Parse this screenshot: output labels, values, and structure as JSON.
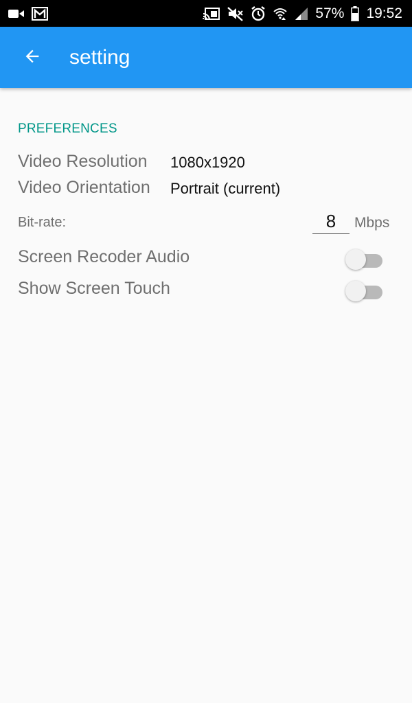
{
  "status_bar": {
    "battery": "57%",
    "time": "19:52",
    "left_icons": [
      "video-camera-icon",
      "gmail-icon"
    ],
    "right_icons": [
      "cast-icon",
      "mute-icon",
      "alarm-icon",
      "wifi-icon",
      "signal-icon",
      "battery-icon"
    ]
  },
  "app_bar": {
    "title": "setting",
    "back_icon": "arrow-back-icon",
    "color": "#2196f3"
  },
  "preferences": {
    "header": "PREFERENCES",
    "header_color": "#009688",
    "video_resolution": {
      "label": "Video Resolution",
      "value": "1080x1920"
    },
    "video_orientation": {
      "label": "Video Orientation",
      "value": "Portrait (current)"
    },
    "bitrate": {
      "label": "Bit-rate:",
      "value": "8",
      "unit": "Mbps"
    },
    "screen_recorder_audio": {
      "label": "Screen Recoder Audio",
      "enabled": false
    },
    "show_screen_touch": {
      "label": "Show Screen Touch",
      "enabled": false
    }
  }
}
